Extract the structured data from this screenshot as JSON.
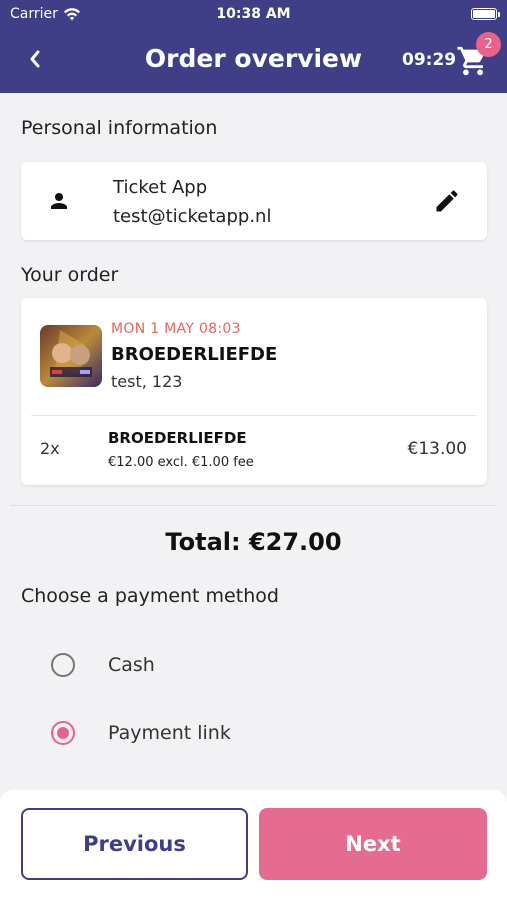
{
  "status_bar": {
    "carrier": "Carrier",
    "time": "10:38 AM"
  },
  "header": {
    "title": "Order overview",
    "timer": "09:29",
    "cart_count": "2",
    "back_icon": "chevron-left-icon",
    "cart_icon": "shopping-cart-icon"
  },
  "personal": {
    "section_title": "Personal information",
    "name": "Ticket App",
    "email": "test@ticketapp.nl"
  },
  "order": {
    "section_title": "Your order",
    "event": {
      "date": "MON 1 MAY 08:03",
      "name": "BROEDERLIEFDE",
      "location": "test, 123"
    },
    "tickets": [
      {
        "quantity": "2x",
        "name": "BROEDERLIEFDE",
        "price_detail": "€12.00 excl. €1.00 fee",
        "total": "€13.00"
      }
    ]
  },
  "total": "Total: €27.00",
  "payment": {
    "section_title": "Choose a payment method",
    "options": [
      {
        "label": "Cash",
        "selected": false
      },
      {
        "label": "Payment link",
        "selected": true
      }
    ]
  },
  "footer": {
    "previous_label": "Previous",
    "next_label": "Next"
  },
  "colors": {
    "header_bg": "#403e86",
    "accent": "#e8628a",
    "next_button": "#e56b91",
    "date_text": "#e8645a"
  }
}
